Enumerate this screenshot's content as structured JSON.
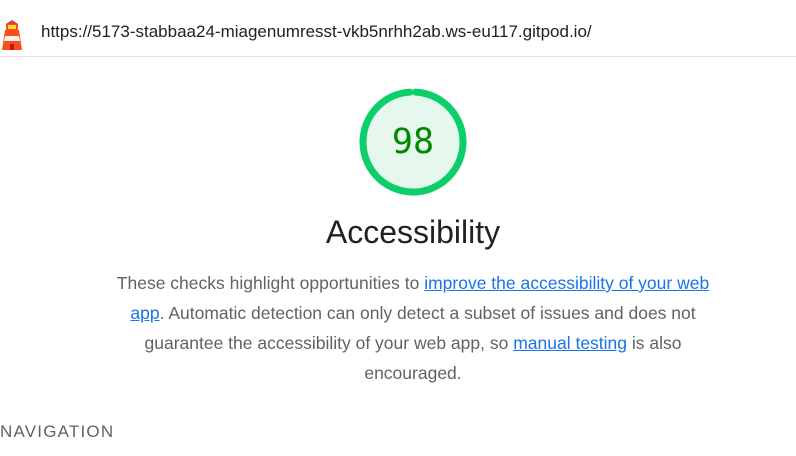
{
  "topbar": {
    "url": "https://5173-stabbaa24-miagenumresst-vkb5nrhh2ab.ws-eu117.gitpod.io/",
    "icon": "lighthouse-icon"
  },
  "gauge": {
    "score": "98",
    "score_fraction": 0.98,
    "ring_color": "#0cce6b",
    "fill_color": "#e6f8ed",
    "text_color": "#008800"
  },
  "category": {
    "title": "Accessibility",
    "desc_part1": "These checks highlight opportunities to ",
    "link1_text": "improve the accessibility of your web app",
    "desc_part2": ". Automatic detection can only detect a subset of issues and does not guarantee the accessibility of your web app, so ",
    "link2_text": "manual testing",
    "desc_part3": " is also encouraged."
  },
  "sections": {
    "navigation_heading": "Navigation"
  }
}
